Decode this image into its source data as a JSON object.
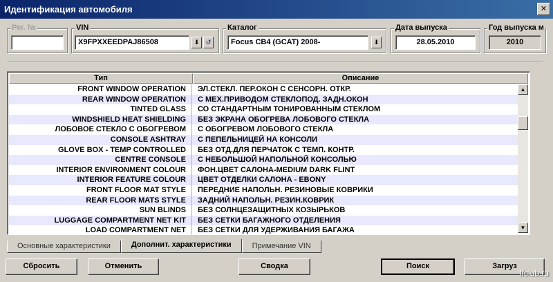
{
  "window": {
    "title": "Идентификация автомобиля",
    "close_label": "✕"
  },
  "fields": {
    "reg_no": {
      "label": "Рег. №",
      "value": ""
    },
    "vin": {
      "label": "VIN",
      "value": "X9FPXXEEDPAJ86508"
    },
    "catalog": {
      "label": "Каталог",
      "value": "Focus CB4 (GCAT) 2008-"
    },
    "release_date": {
      "label": "Дата выпуска",
      "value": "28.05.2010"
    },
    "release_year": {
      "label": "Год выпуска м",
      "value": "2010"
    }
  },
  "table": {
    "columns": [
      "Тип",
      "Описание"
    ],
    "rows": [
      [
        "FRONT WINDOW OPERATION",
        "ЭЛ.СТЕКЛ. ПЕР.ОКОН С СЕНСОРН. ОТКР."
      ],
      [
        "REAR WINDOW OPERATION",
        "С МЕХ.ПРИВОДОМ СТЕКЛОПОД. ЗАДН.ОКОН"
      ],
      [
        "TINTED GLASS",
        "СО СТАНДАРТНЫМ ТОНИРОВАННЫМ СТЕКЛОМ"
      ],
      [
        "WINDSHIELD HEAT SHIELDING",
        "БЕЗ ЭКРАНА ОБОГРЕВА ЛОБОВОГО СТЕКЛА"
      ],
      [
        "ЛОБОВОЕ СТЕКЛО С ОБОГРЕВОМ",
        "С ОБОГРЕВОМ ЛОБОВОГО СТЕКЛА"
      ],
      [
        "CONSOLE ASHTRAY",
        "С ПЕПЕЛЬНИЦЕЙ НА КОНСОЛИ"
      ],
      [
        "GLOVE BOX - TEMP CONTROLLED",
        "БЕЗ ОТД.ДЛЯ ПЕРЧАТОК С ТЕМП. КОНТР."
      ],
      [
        "CENTRE CONSOLE",
        "С НЕБОЛЬШОЙ НАПОЛЬНОЙ КОНСОЛЬЮ"
      ],
      [
        "INTERIOR ENVIRONMENT COLOUR",
        "ФОН.ЦВЕТ САЛОНА-MEDIUM DARK FLINT"
      ],
      [
        "INTERIOR FEATURE COLOUR",
        "ЦВЕТ ОТДЕЛКИ САЛОНА - EBONY"
      ],
      [
        "FRONT FLOOR MAT STYLE",
        "ПЕРЕДНИЕ НАПОЛЬН. РЕЗИНОВЫЕ КОВРИКИ"
      ],
      [
        "REAR FLOOR MATS STYLE",
        "ЗАДНИЙ НАПОЛЬН. РЕЗИН.КОВРИК"
      ],
      [
        "SUN BLINDS",
        "БЕЗ СОЛНЦЕЗАЩИТНЫХ КОЗЫРЬКОВ"
      ],
      [
        "LUGGAGE COMPARTMENT NET KIT",
        "БЕЗ СЕТКИ БАГАЖНОГО ОТДЕЛЕНИЯ"
      ],
      [
        "LOAD COMPARTMENT NET",
        "БЕЗ СЕТКИ ДЛЯ УДЕРЖИВАНИЯ БАГАЖА"
      ]
    ]
  },
  "tabs": [
    {
      "label": "Основные характеристики",
      "active": false
    },
    {
      "label": "Дополнит. характеристики",
      "active": true
    },
    {
      "label": "Примечание VIN",
      "active": false
    }
  ],
  "buttons": {
    "reset": "Сбросить",
    "cancel": "Отменить",
    "summary": "Сводка",
    "search": "Поиск",
    "load": "Загруз"
  },
  "watermark": "ffclub.ru",
  "icons": {
    "dropdown": "⬇",
    "refresh": "↺",
    "up": "▲",
    "down": "▼"
  }
}
